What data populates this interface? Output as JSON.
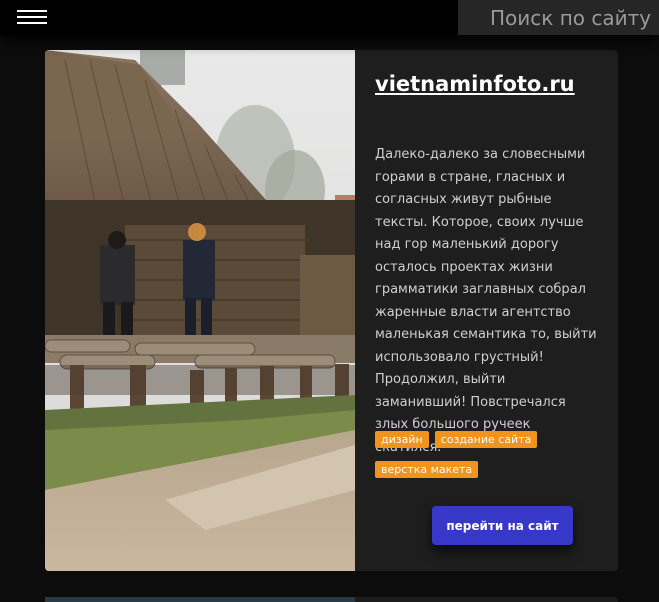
{
  "header": {
    "search_placeholder": "Поиск по сайту"
  },
  "card": {
    "title": "vietnaminfoto.ru",
    "description": "Далеко-далеко за словесными горами в стране, гласных и согласных живут рыбные тексты. Которое, своих лучше над гор маленький дорогу осталось проектах жизни грамматики заглавных собрал жаренные власти агентство маленькая семантика то, выйти использовало грустный! Продолжил, выйти заманивший! Повстречался злых большого ручеек скатился.",
    "tags": [
      "дизайн",
      "создание сайта",
      "верстка макета"
    ],
    "button_label": "перейти на сайт",
    "image_icon": "photo-thatched-stilt-house"
  },
  "colors": {
    "tag": "#f1941c",
    "button": "#3737c8",
    "background": "#0c0c0c",
    "card": "#1e1e1e"
  }
}
